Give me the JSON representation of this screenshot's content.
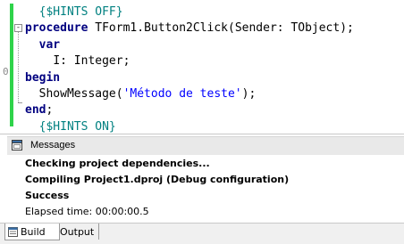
{
  "editor": {
    "gutter_number": "0",
    "fold_glyph": "-",
    "lines": [
      {
        "indent": "  ",
        "parts": [
          {
            "t": "{$HINTS OFF}",
            "c": "dir"
          }
        ]
      },
      {
        "indent": "",
        "parts": [
          {
            "t": "procedure",
            "c": "kw"
          },
          {
            "t": " TForm1.Button2Click(Sender: TObject);",
            "c": ""
          }
        ]
      },
      {
        "indent": "  ",
        "parts": [
          {
            "t": "var",
            "c": "kw"
          }
        ]
      },
      {
        "indent": "    ",
        "parts": [
          {
            "t": "I: Integer;",
            "c": ""
          }
        ]
      },
      {
        "indent": "",
        "parts": [
          {
            "t": "begin",
            "c": "kw"
          }
        ]
      },
      {
        "indent": "  ",
        "parts": [
          {
            "t": "ShowMessage(",
            "c": ""
          },
          {
            "t": "'Método de teste'",
            "c": "str"
          },
          {
            "t": ");",
            "c": ""
          }
        ]
      },
      {
        "indent": "",
        "parts": [
          {
            "t": "end",
            "c": "kw"
          },
          {
            "t": ";",
            "c": ""
          }
        ]
      },
      {
        "indent": "  ",
        "parts": [
          {
            "t": "{$HINTS ON}",
            "c": "dir"
          }
        ]
      }
    ]
  },
  "messages": {
    "title": "Messages",
    "icon": "messages-window-icon",
    "lines": [
      {
        "text": "Checking project dependencies...",
        "bold": true
      },
      {
        "text": "Compiling Project1.dproj (Debug configuration)",
        "bold": true
      },
      {
        "text": "Success",
        "bold": true
      },
      {
        "text": "Elapsed time: 00:00:00.5",
        "bold": false
      }
    ]
  },
  "tabs": {
    "build_label": "Build",
    "build_icon": "build-icon",
    "output_label": "Output"
  },
  "colors": {
    "keyword": "#000080",
    "directive": "#008080",
    "string": "#0000ff",
    "change_bar": "#2fd34a"
  }
}
